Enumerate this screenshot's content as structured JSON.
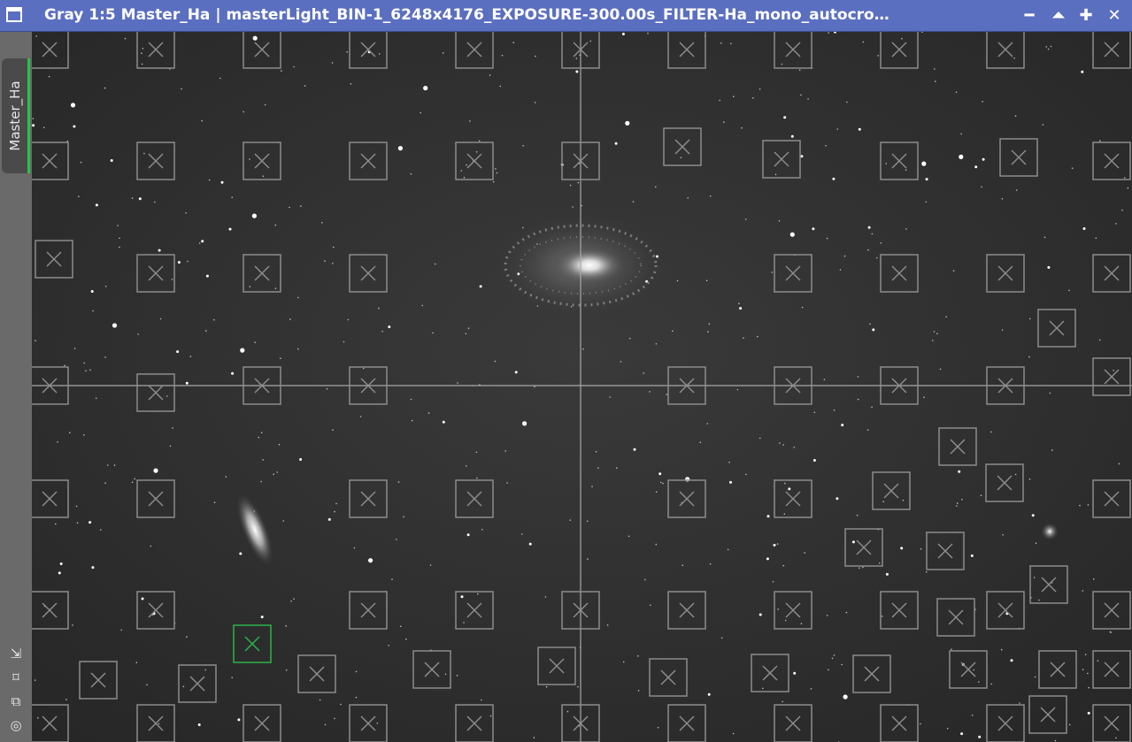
{
  "window": {
    "title": "Gray 1:5 Master_Ha | masterLight_BIN-1_6248x4176_EXPOSURE-300.00s_FILTER-Ha_mono_autocro…",
    "buttons": [
      {
        "name": "minimize-icon",
        "glyph": "━"
      },
      {
        "name": "shade-icon",
        "glyph": "⏶"
      },
      {
        "name": "maximize-icon",
        "glyph": "✚"
      },
      {
        "name": "close-icon",
        "glyph": "✕"
      }
    ]
  },
  "view_tab": {
    "label": "Master_Ha"
  },
  "side_tools": [
    {
      "name": "fit-view-icon",
      "glyph": "⇲"
    },
    {
      "name": "zoom-fit-icon",
      "glyph": "⌑"
    },
    {
      "name": "clone-view-icon",
      "glyph": "⧉"
    },
    {
      "name": "preview-target-icon",
      "glyph": "◎"
    }
  ],
  "colors": {
    "titlebar": "#5b6fc0",
    "box_normal": "#8c8c8c",
    "box_selected": "#2bb34a",
    "crosshair": "#a8a8a8"
  }
}
